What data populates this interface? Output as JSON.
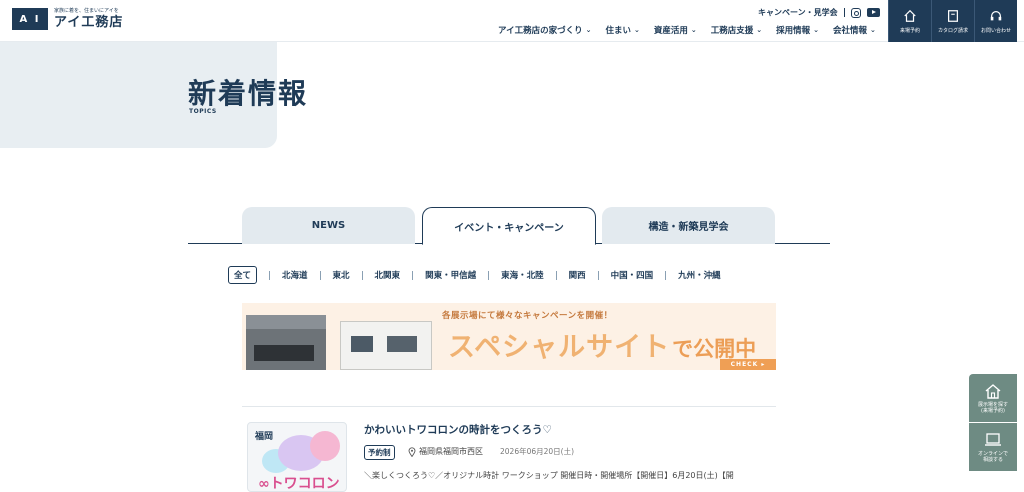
{
  "header": {
    "logo_mark": "A I",
    "logo_tagline": "家族に着を、住まいにアイを",
    "logo_name": "アイ工務店",
    "top_link": "キャンペーン・見学会",
    "nav": [
      {
        "label": "アイ工務店の家づくり"
      },
      {
        "label": "住まい"
      },
      {
        "label": "資産活用"
      },
      {
        "label": "工務店支援"
      },
      {
        "label": "採用情報"
      },
      {
        "label": "会社情報"
      }
    ],
    "buttons": [
      {
        "label": "来場予約",
        "icon": "house-icon"
      },
      {
        "label": "カタログ請求",
        "icon": "book-icon"
      },
      {
        "label": "お問い合わせ",
        "icon": "headset-icon"
      }
    ]
  },
  "hero": {
    "title": "新着情報",
    "subtitle": "TOPICS"
  },
  "tabs": [
    {
      "label": "NEWS",
      "active": false
    },
    {
      "label": "イベント・キャンペーン",
      "active": true
    },
    {
      "label": "構造・新築見学会",
      "active": false
    }
  ],
  "regions": [
    "全て",
    "北海道",
    "東北",
    "北関東",
    "関東・甲信越",
    "東海・北陸",
    "関西",
    "中国・四国",
    "九州・沖縄"
  ],
  "banner": {
    "small_text": "各展示場にて様々なキャンペーンを開催！",
    "big_text": "スペシャルサイト",
    "big_tail": "で公開中",
    "check": "CHECK ▸"
  },
  "article": {
    "image_tag": "福岡",
    "image_logo": "∞トワコロン",
    "title": "かわいいトワコロンの時計をつくろう♡",
    "badge": "予約制",
    "location": "福岡県福岡市西区",
    "date": "2026年06月20日(土)",
    "description": "＼楽しくつくろう♡／オリジナル時計 ワークショップ 開催日時・開催場所【開催日】6月20日(土)【開"
  },
  "floating": [
    {
      "label": "展示場を探す\n(来場予約)",
      "icon": "house-icon"
    },
    {
      "label": "オンラインで\n相談する",
      "icon": "laptop-icon"
    }
  ]
}
